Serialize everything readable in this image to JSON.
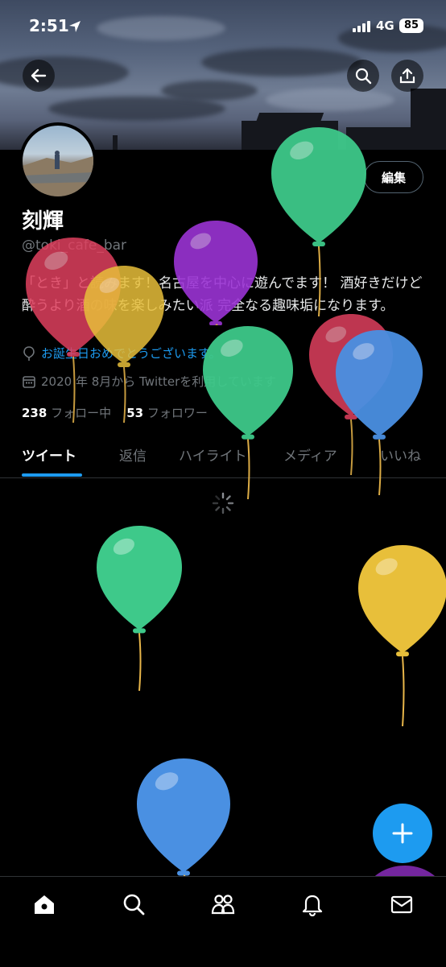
{
  "status_bar": {
    "time": "2:51",
    "network": "4G",
    "battery": "85"
  },
  "header": {
    "back_icon": "arrow-left-icon",
    "search_icon": "search-icon",
    "share_icon": "share-icon"
  },
  "profile": {
    "name": "刻輝",
    "handle": "@toki_cafe_bar",
    "edit_label": "編集",
    "bio": "「とき」と読みます！名古屋を中心に遊んでます！ 酒好きだけど酔うより酒の味を楽しみたい派 完全なる趣味垢になります。",
    "birthday": "お誕生日おめでとうございます。",
    "joined": "2020 年 8月から Twitterを利用しています",
    "following_count": "238",
    "following_label": "フォロー中",
    "followers_count": "53",
    "followers_label": "フォロワー"
  },
  "tabs": [
    {
      "label": "ツイート",
      "active": true
    },
    {
      "label": "返信"
    },
    {
      "label": "ハイライト"
    },
    {
      "label": "メディア"
    },
    {
      "label": "いいね"
    }
  ],
  "bottom_nav": [
    "home-icon",
    "search-icon",
    "communities-icon",
    "notifications-icon",
    "messages-icon"
  ],
  "colors": {
    "accent": "#1d9bf0",
    "background": "#000000"
  },
  "balloon_colors": [
    "#e0405f",
    "#e8bf3a",
    "#9b33d4",
    "#3ec98a",
    "#4a90e2"
  ]
}
